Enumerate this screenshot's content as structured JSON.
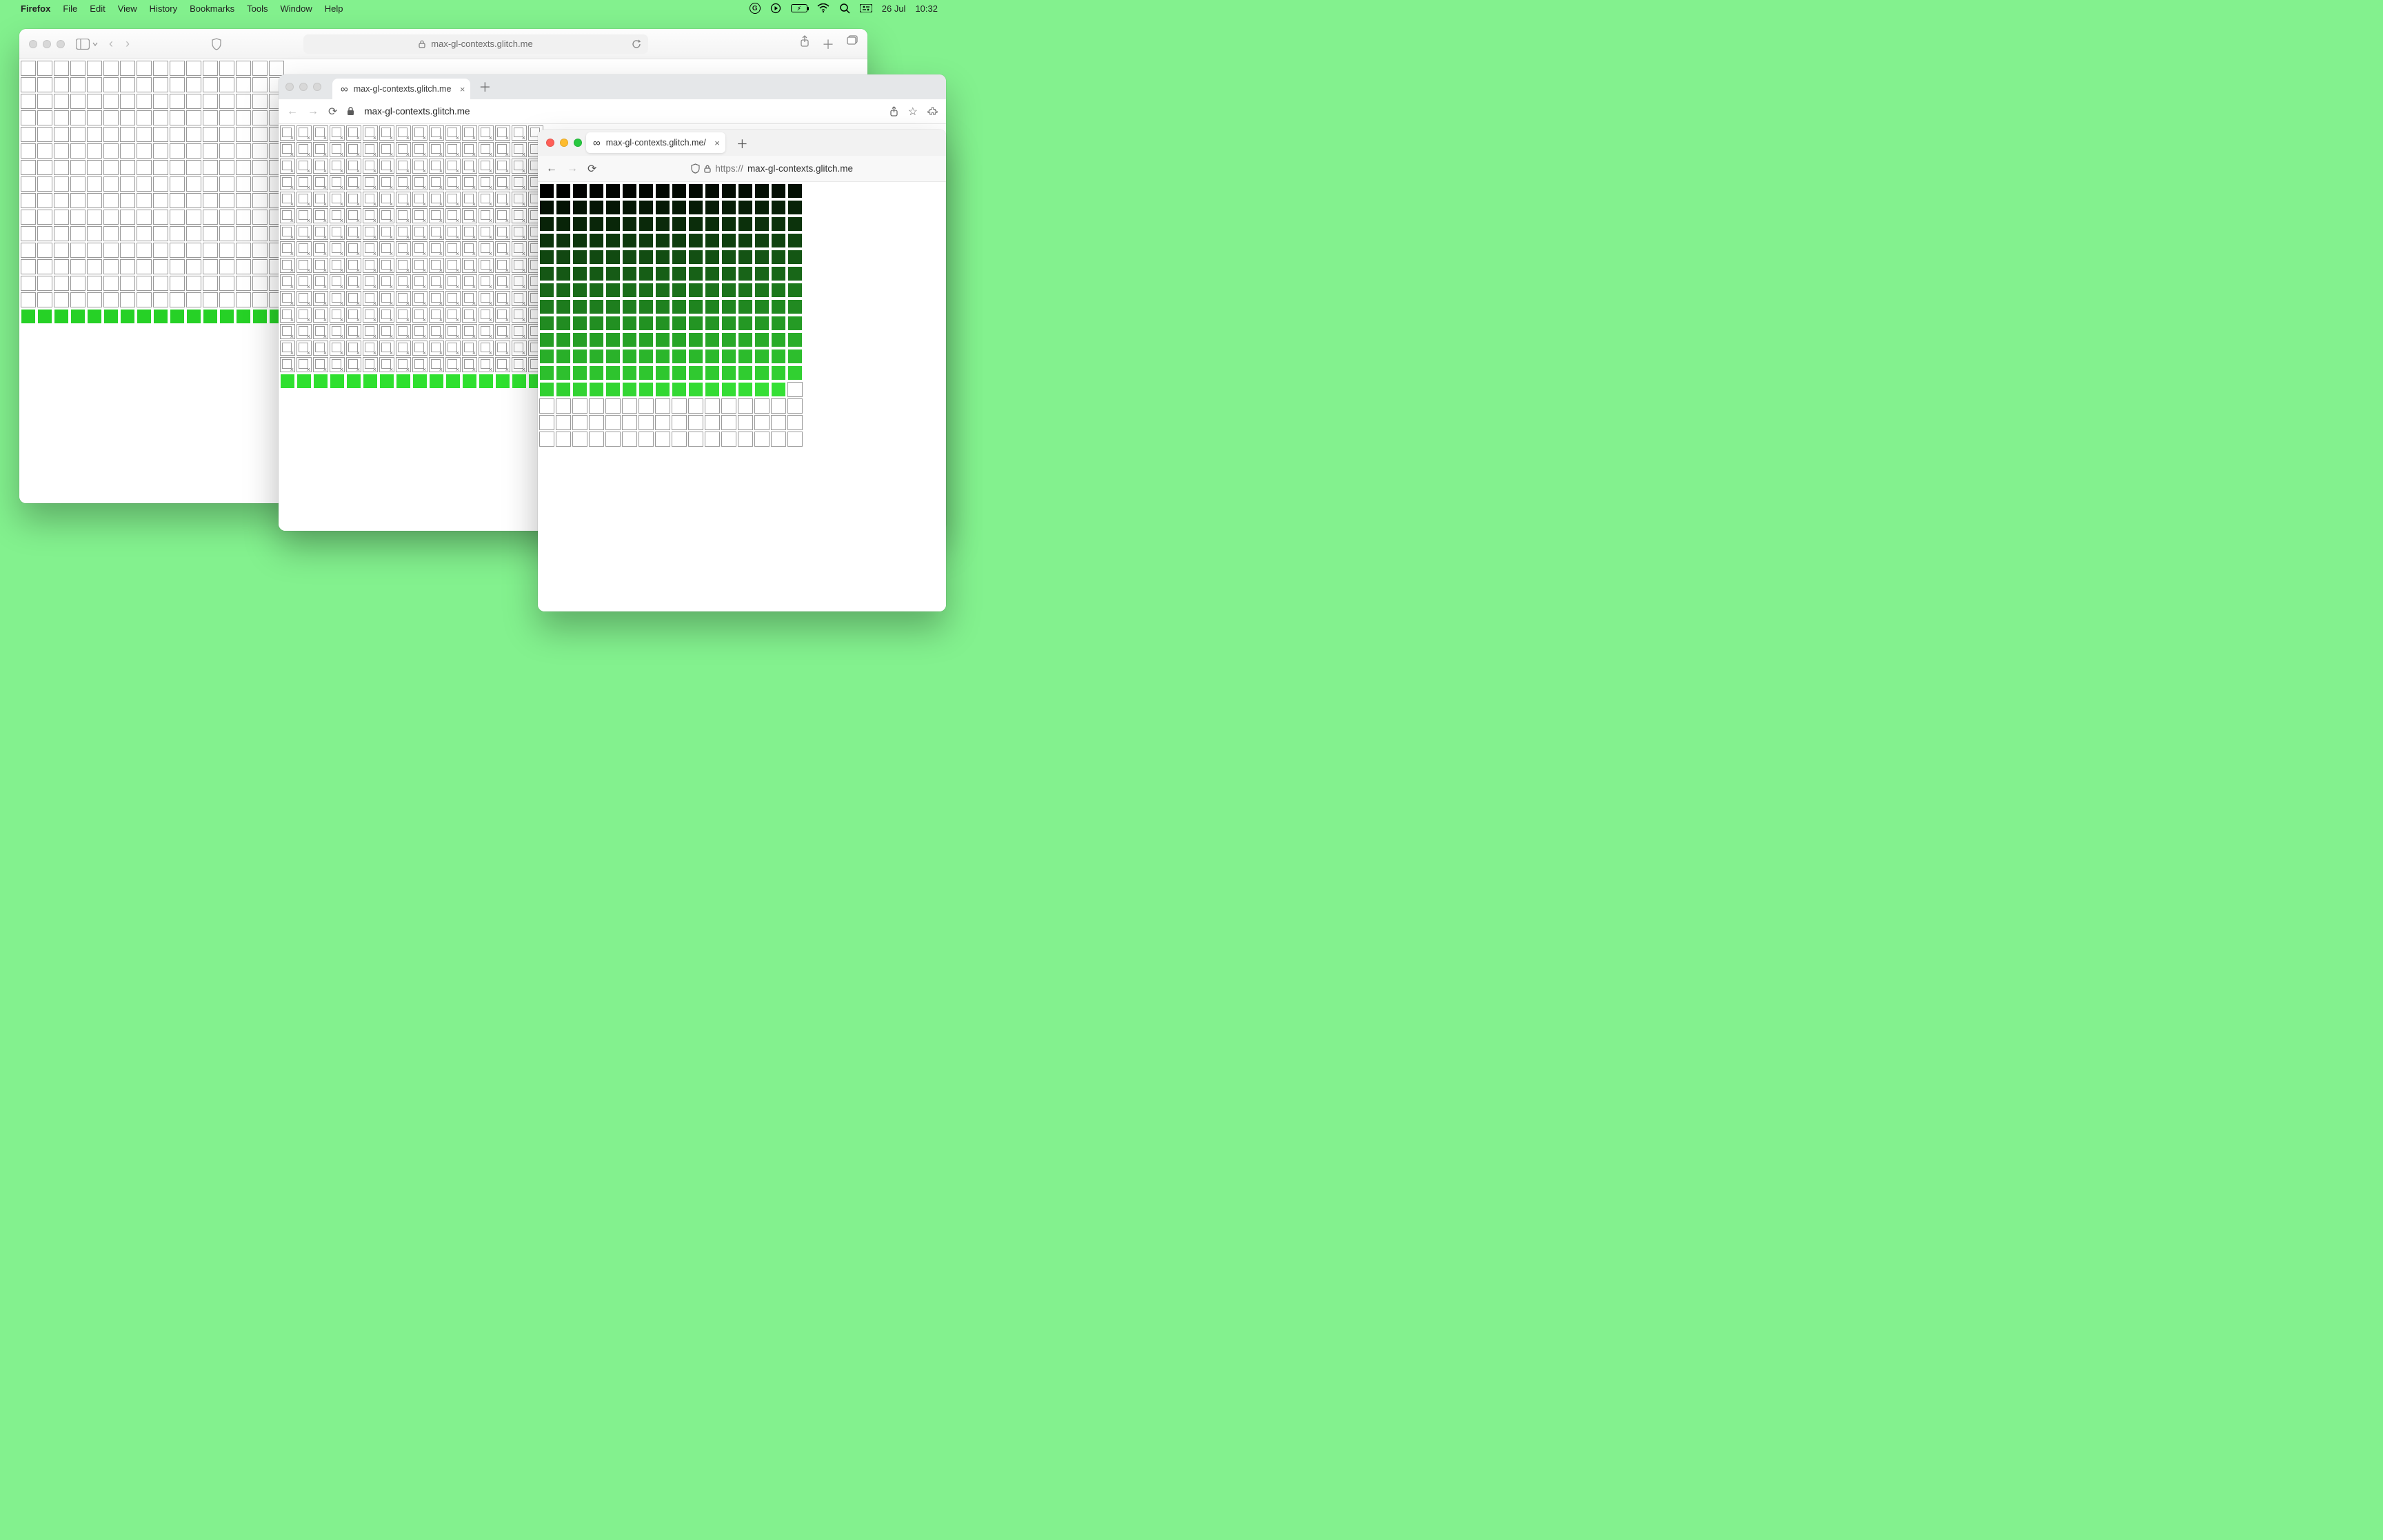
{
  "menubar": {
    "app": "Firefox",
    "items": [
      "File",
      "Edit",
      "View",
      "History",
      "Bookmarks",
      "Tools",
      "Window",
      "Help"
    ],
    "date": "26 Jul",
    "time": "10:32",
    "battery_glyph": "⚡︎"
  },
  "safari": {
    "url_display": "max-gl-contexts.glitch.me",
    "grid": {
      "cols": 16,
      "rows": 16,
      "cell": 22,
      "white_rows": 15,
      "green_rows": 1,
      "green_color": "#26d126"
    }
  },
  "chrome": {
    "tab_title": "max-gl-contexts.glitch.me",
    "url_display": "max-gl-contexts.glitch.me",
    "favicon": "∞",
    "grid": {
      "cols": 16,
      "rows": 16,
      "cell": 22,
      "broken_rows": 15,
      "green_rows": 1,
      "green_color": "#2fe02f"
    }
  },
  "firefox": {
    "tab_title": "max-gl-contexts.glitch.me/",
    "url_proto": "https://",
    "url_host": "max-gl-contexts.glitch.me",
    "favicon": "∞",
    "grid": {
      "cols": 16,
      "rows": 16,
      "cell": 22,
      "filled_cells": 207,
      "empty_cells": 49,
      "gradient_start": "#000000",
      "gradient_end": "#35e035"
    }
  }
}
